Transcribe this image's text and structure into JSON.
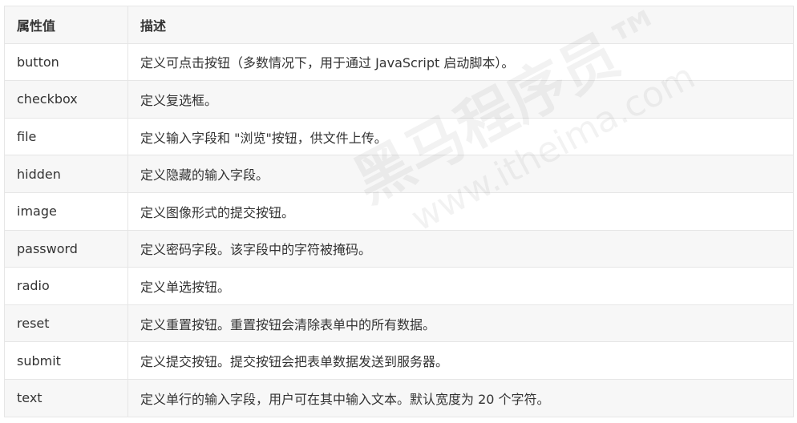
{
  "table": {
    "headers": [
      "属性值",
      "描述"
    ],
    "rows": [
      [
        "button",
        "定义可点击按钮（多数情况下，用于通过 JavaScript 启动脚本）。"
      ],
      [
        "checkbox",
        "定义复选框。"
      ],
      [
        "file",
        "定义输入字段和 \"浏览\"按钮，供文件上传。"
      ],
      [
        "hidden",
        "定义隐藏的输入字段。"
      ],
      [
        "image",
        "定义图像形式的提交按钮。"
      ],
      [
        "password",
        "定义密码字段。该字段中的字符被掩码。"
      ],
      [
        "radio",
        "定义单选按钮。"
      ],
      [
        "reset",
        "定义重置按钮。重置按钮会清除表单中的所有数据。"
      ],
      [
        "submit",
        "定义提交按钮。提交按钮会把表单数据发送到服务器。"
      ],
      [
        "text",
        "定义单行的输入字段，用户可在其中输入文本。默认宽度为 20 个字符。"
      ]
    ]
  },
  "watermark": {
    "brand": "黑马程序员™",
    "url": "www.itheima.com"
  }
}
